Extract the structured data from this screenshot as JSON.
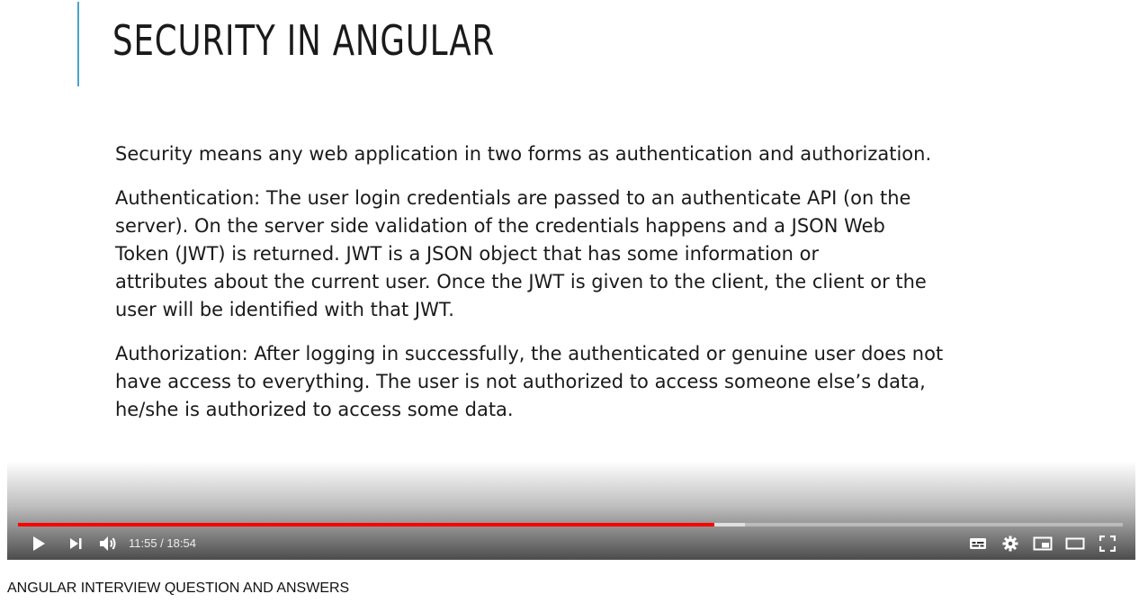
{
  "slide": {
    "title": "SECURITY IN ANGULAR",
    "paragraphs": [
      "Security means any web application in two forms as authentication and authorization.",
      "Authentication: The user login credentials are passed to an authenticate API (on the\nserver). On the server side validation of the credentials happens and a JSON Web\nToken (JWT) is returned. JWT is a JSON object that has some information or\nattributes about the current user.  Once the JWT is given to the client, the client or the\nuser will be identified with that JWT.",
      "Authorization: After logging in successfully, the authenticated or genuine user does not\nhave access to everything. The user is not authorized to access someone else’s data,\nhe/she is authorized to access some data."
    ],
    "accent_color": "#4aa3c8"
  },
  "player": {
    "time_display": "11:55 / 18:54",
    "progress_played_fraction": 0.6306,
    "progress_buffered_fraction": 0.658,
    "progress_color": "#ff0000",
    "icons": {
      "play": "play-icon",
      "next": "next-icon",
      "volume": "volume-icon",
      "subtitles": "subtitles-icon",
      "settings": "settings-gear-icon",
      "miniplayer": "miniplayer-icon",
      "theater": "theater-mode-icon",
      "fullscreen": "fullscreen-icon"
    }
  },
  "video_title": "ANGULAR INTERVIEW QUESTION AND ANSWERS"
}
